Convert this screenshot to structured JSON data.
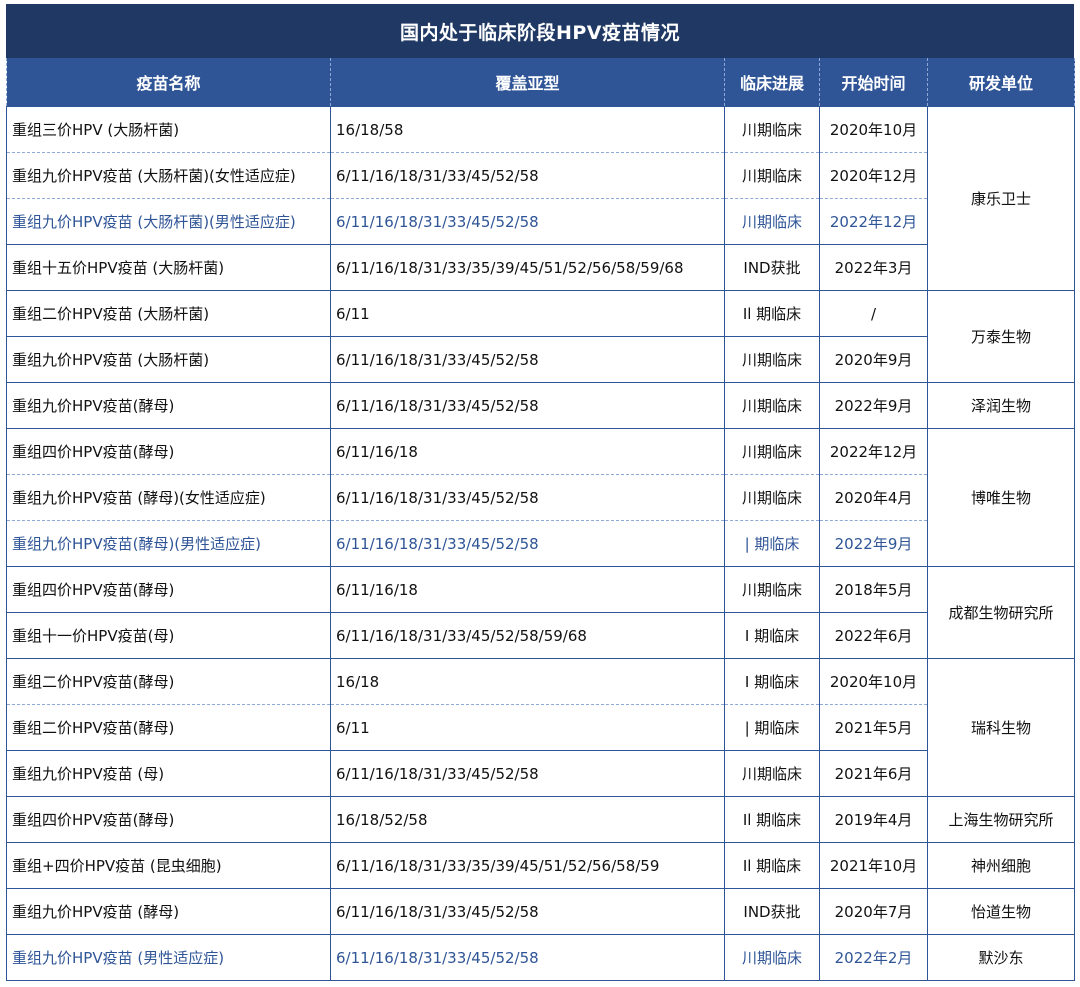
{
  "title": "国内处于临床阶段HPV疫苗情况",
  "headers": [
    "疫苗名称",
    "覆盖亚型",
    "临床进展",
    "开始时间",
    "研发单位"
  ],
  "rows": [
    {
      "name": "重组三价HPV (大肠杆菌)",
      "types": "16/18/58",
      "stage": "川期临床",
      "start": "2020年10月"
    },
    {
      "name": "重组九价HPV疫苗 (大肠杆菌)(女性适应症)",
      "types": "6/11/16/18/31/33/45/52/58",
      "stage": "川期临床",
      "start": "2020年12月"
    },
    {
      "name": "重组九价HPV疫苗 (大肠杆菌)(男性适应症)",
      "types": "6/11/16/18/31/33/45/52/58",
      "stage": "川期临床",
      "start": "2022年12月"
    },
    {
      "name": "重组十五价HPV疫苗 (大肠杆菌)",
      "types": "6/11/16/18/31/33/35/39/45/51/52/56/58/59/68",
      "stage": "IND获批",
      "start": "2022年3月"
    },
    {
      "name": "重组二价HPV疫苗 (大肠杆菌)",
      "types": "6/11",
      "stage": "Il 期临床",
      "start": "/"
    },
    {
      "name": "重组九价HPV疫苗 (大肠杆菌)",
      "types": "6/11/16/18/31/33/45/52/58",
      "stage": "川期临床",
      "start": "2020年9月"
    },
    {
      "name": "重组九价HPV疫苗(酵母)",
      "types": "6/11/16/18/31/33/45/52/58",
      "stage": "川期临床",
      "start": "2022年9月"
    },
    {
      "name": "重组四价HPV疫苗(酵母)",
      "types": "6/11/16/18",
      "stage": "川期临床",
      "start": "2022年12月"
    },
    {
      "name": "重组九价HPV疫苗 (酵母)(女性适应症)",
      "types": "6/11/16/18/31/33/45/52/58",
      "stage": "川期临床",
      "start": "2020年4月"
    },
    {
      "name": "重组九价HPV疫苗(酵母)(男性适应症)",
      "types": "6/11/16/18/31/33/45/52/58",
      "stage": "| 期临床",
      "start": "2022年9月"
    },
    {
      "name": "重组四价HPV疫苗(酵母)",
      "types": "6/11/16/18",
      "stage": "川期临床",
      "start": "2018年5月"
    },
    {
      "name": "重组十一价HPV疫苗(母)",
      "types": "6/11/16/18/31/33/45/52/58/59/68",
      "stage": "I 期临床",
      "start": "2022年6月"
    },
    {
      "name": "重组二价HPV疫苗(酵母)",
      "types": "16/18",
      "stage": "I 期临床",
      "start": "2020年10月"
    },
    {
      "name": "重组二价HPV疫苗(酵母)",
      "types": "6/11",
      "stage": "| 期临床",
      "start": "2021年5月"
    },
    {
      "name": "重组九价HPV疫苗 (母)",
      "types": "6/11/16/18/31/33/45/52/58",
      "stage": "川期临床",
      "start": "2021年6月"
    },
    {
      "name": "重组四价HPV疫苗(酵母)",
      "types": "16/18/52/58",
      "stage": "Il 期临床",
      "start": "2019年4月"
    },
    {
      "name": "重组+四价HPV疫苗 (昆虫细胞)",
      "types": "6/11/16/18/31/33/35/39/45/51/52/56/58/59",
      "stage": "Il 期临床",
      "start": "2021年10月"
    },
    {
      "name": "重组九价HPV疫苗 (酵母)",
      "types": "6/11/16/18/31/33/45/52/58",
      "stage": "IND获批",
      "start": "2020年7月"
    },
    {
      "name": "重组九价HPV疫苗 (男性适应症)",
      "types": "6/11/16/18/31/33/45/52/58",
      "stage": "川期临床",
      "start": "2022年2月"
    }
  ],
  "units": [
    "康乐卫士",
    "万泰生物",
    "泽润生物",
    "博唯生物",
    "成都生物研究所",
    "瑞科生物",
    "上海生物研究所",
    "神州细胞",
    "怡道生物",
    "默沙东"
  ],
  "highlight_color": "#2f5597"
}
